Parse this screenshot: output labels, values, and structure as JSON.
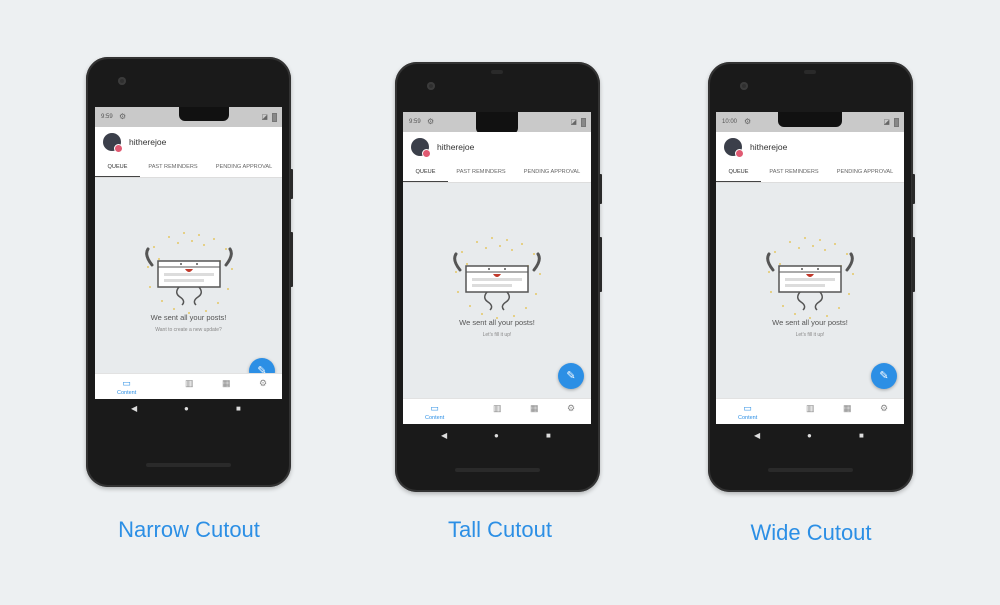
{
  "mockups": [
    {
      "caption": "Narrow Cutout",
      "time": "9:59",
      "username": "hitherejoe",
      "tabs": [
        "QUEUE",
        "PAST REMINDERS",
        "PENDING APPROVAL"
      ],
      "message": "We sent all your posts!",
      "submessage": "Want to create a new update?",
      "nav_label": "Content"
    },
    {
      "caption": "Tall Cutout",
      "time": "9:59",
      "username": "hitherejoe",
      "tabs": [
        "QUEUE",
        "PAST REMINDERS",
        "PENDING APPROVAL"
      ],
      "message": "We sent all your posts!",
      "submessage": "Let's fill it up!",
      "nav_label": "Content"
    },
    {
      "caption": "Wide Cutout",
      "time": "10:00",
      "username": "hitherejoe",
      "tabs": [
        "QUEUE",
        "PAST REMINDERS",
        "PENDING APPROVAL"
      ],
      "message": "We sent all your posts!",
      "submessage": "Let's fill it up!",
      "nav_label": "Content"
    }
  ],
  "icons": {
    "settings": "gear-icon",
    "edit": "pencil-icon",
    "content": "content-icon",
    "analytics": "bar-chart-icon",
    "calendar": "calendar-icon",
    "back": "triangle-back-icon",
    "home": "circle-home-icon",
    "recents": "square-recents-icon"
  },
  "colors": {
    "accent": "#2c8fe5",
    "background": "#edf0f2",
    "screen": "#e8ebed"
  }
}
